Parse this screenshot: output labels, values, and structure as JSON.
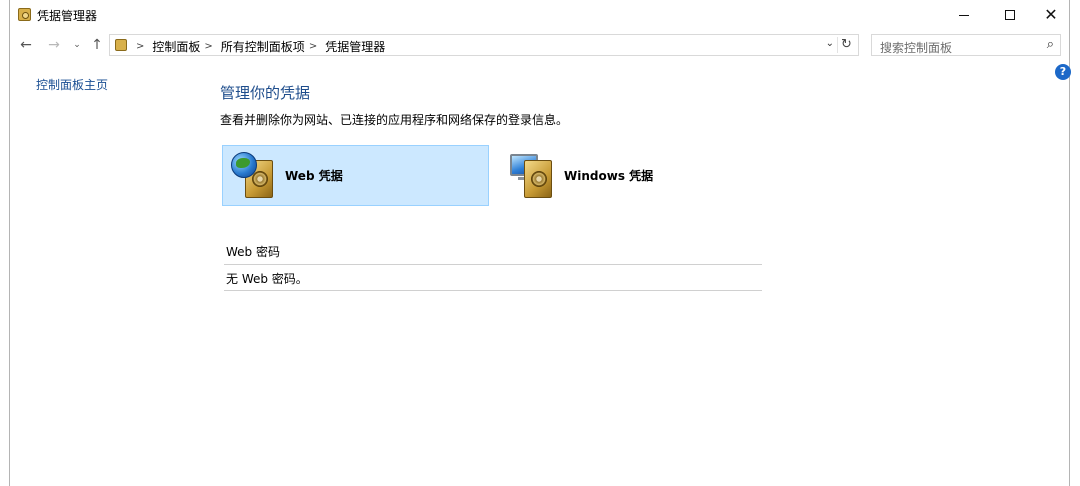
{
  "window": {
    "title": "凭据管理器",
    "icon": "credential-manager-icon"
  },
  "nav": {
    "back_icon": "←",
    "forward_icon": "→",
    "recent_icon": "⌄",
    "up_icon": "↑"
  },
  "address": {
    "crumbs": [
      "控制面板",
      "所有控制面板项",
      "凭据管理器"
    ],
    "separator": ">",
    "dropdown_icon": "⌄",
    "refresh_icon": "↻"
  },
  "search": {
    "placeholder": "搜索控制面板",
    "icon": "⌕"
  },
  "help": {
    "label": "?"
  },
  "left_pane": {
    "home_link": "控制面板主页"
  },
  "main": {
    "title": "管理你的凭据",
    "description": "查看并删除你为网站、已连接的应用程序和网络保存的登录信息。",
    "tiles": [
      {
        "label": "Web 凭据",
        "icon": "web-credential-icon",
        "selected": true
      },
      {
        "label": "Windows 凭据",
        "icon": "windows-credential-icon",
        "selected": false
      }
    ],
    "section_heading": "Web 密码",
    "empty_message": "无 Web 密码。"
  },
  "colors": {
    "link": "#1a4f93",
    "title": "#1e4d8c",
    "selected_tile_bg": "#cce8ff",
    "selected_tile_border": "#99d1ff",
    "help_bg": "#1c68c8"
  }
}
